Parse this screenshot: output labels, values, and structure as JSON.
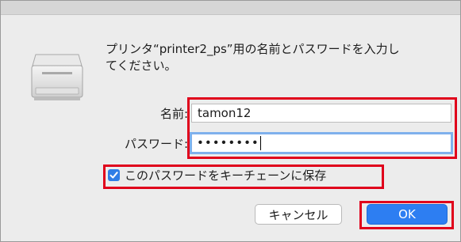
{
  "dialog": {
    "message": "プリンタ“printer2_ps”用の名前とパスワードを入力し\nてください。",
    "icon": "printer-icon"
  },
  "form": {
    "name_label": "名前:",
    "name_value": "tamon12",
    "password_label": "パスワード:",
    "password_value": "••••••••",
    "remember_label": "このパスワードをキーチェーンに保存",
    "remember_checked": true
  },
  "buttons": {
    "cancel": "キャンセル",
    "ok": "OK"
  },
  "colors": {
    "highlight": "#e0001b",
    "accent": "#2d7ef2",
    "focus_ring": "#7fb0ec"
  }
}
